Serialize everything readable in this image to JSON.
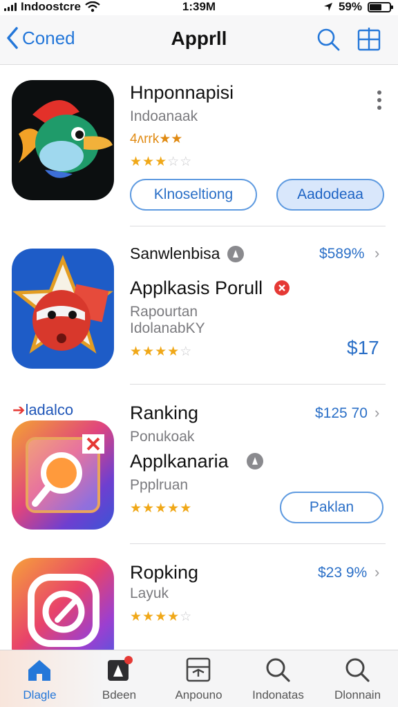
{
  "status_bar": {
    "carrier": "Indoostcre",
    "time": "1:39M",
    "battery": "59%",
    "battery_level": 0.59
  },
  "nav": {
    "back_label": "Coned",
    "title": "Apprll"
  },
  "apps": [
    {
      "name": "Hnponnapisi",
      "developer": "Indoanaak",
      "rating_text": "4ᴧrrk★★",
      "rating": 3,
      "open_button": "Klnoseltiong",
      "get_button": "Aadodeaa"
    },
    {
      "category": "Sanwlenbisa",
      "price": "$589%",
      "name": "Applkasis Porull",
      "line1": "Rapourtan",
      "line2": "IdolanabKY",
      "rating": 4,
      "price2": "$17"
    },
    {
      "section_label": "ladalco",
      "name": "Ranking",
      "price": "$125 70",
      "line1": "Ponukoak",
      "name2": "Applkanaria",
      "line2": "Ppplruan",
      "rating": 4.5,
      "button": "Paklan"
    },
    {
      "name": "Ropking",
      "price": "$23 9%",
      "line1": "Layuk",
      "rating": 4
    }
  ],
  "tabs": [
    {
      "label": "Dlagle",
      "icon": "home-icon",
      "active": true
    },
    {
      "label": "Bdeen",
      "icon": "play-badge-icon",
      "active": false
    },
    {
      "label": "Anpouno",
      "icon": "arcade-icon",
      "active": false
    },
    {
      "label": "Indonatas",
      "icon": "search-icon",
      "active": false
    },
    {
      "label": "Dlonnain",
      "icon": "search-icon",
      "active": false
    }
  ],
  "colors": {
    "accent": "#2477d9",
    "star": "#f0a818",
    "badge_red": "#e53935"
  }
}
